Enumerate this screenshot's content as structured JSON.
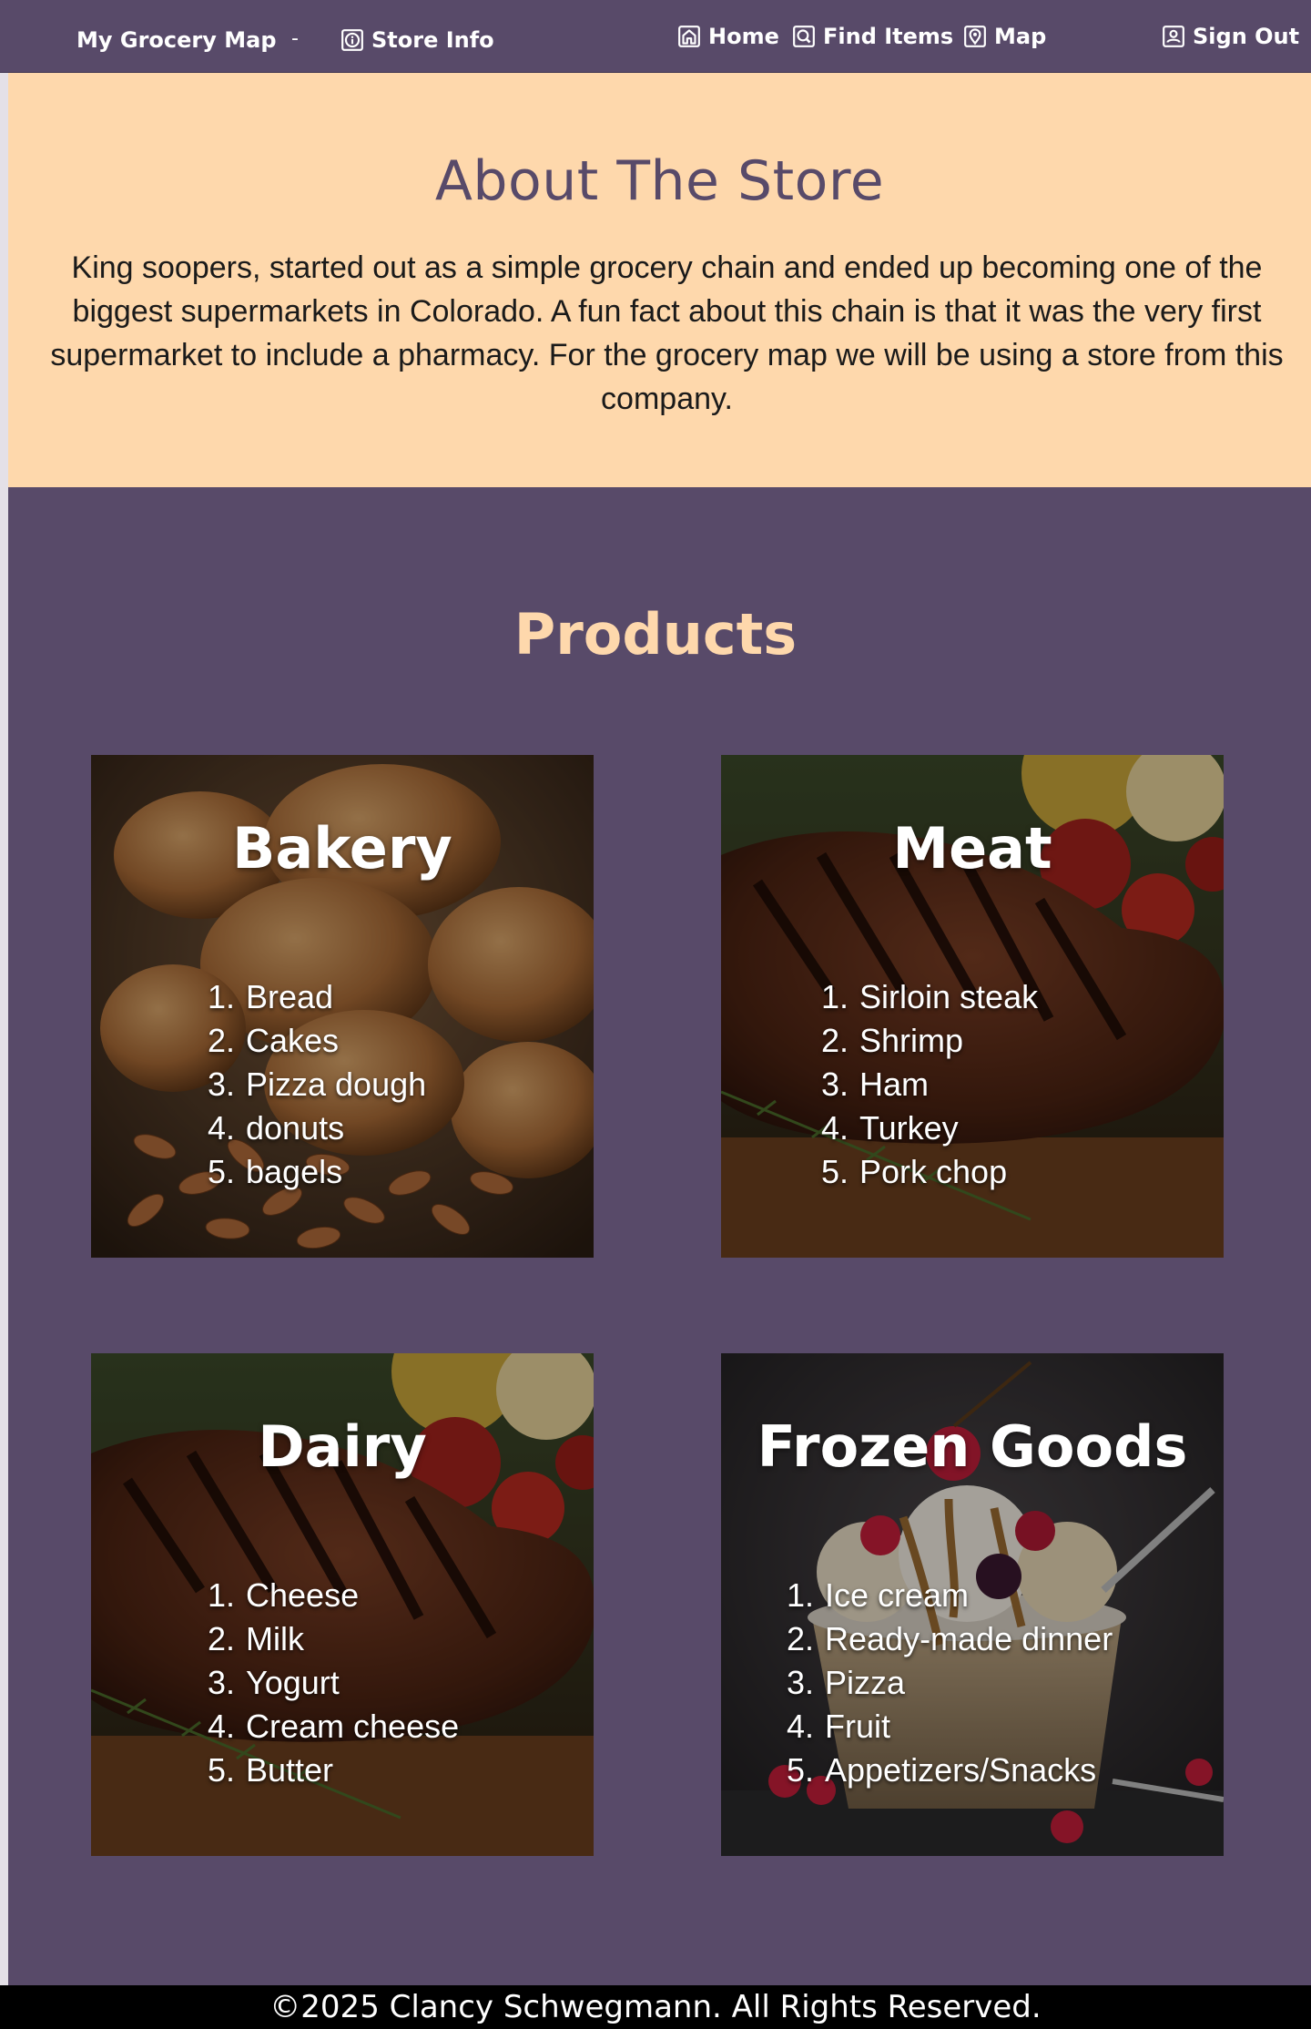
{
  "navbar": {
    "brand": "My Grocery Map",
    "separator": "-",
    "store_info": "Store Info",
    "home": "Home",
    "find_items": "Find Items",
    "map": "Map",
    "sign_out": "Sign Out"
  },
  "about": {
    "title": "About The Store",
    "text": "King soopers, started out as a simple grocery chain and ended up becoming one of the biggest supermarkets in Colorado. A fun fact about this chain is that it was the very first supermarket to include a pharmacy. For the grocery map we will be using a store from this company."
  },
  "products": {
    "title": "Products",
    "cards": [
      {
        "title": "Bakery",
        "items": [
          "Bread",
          "Cakes",
          "Pizza dough",
          "donuts",
          "bagels"
        ],
        "image": "bread-and-almonds"
      },
      {
        "title": "Meat",
        "items": [
          "Sirloin steak",
          "Shrimp",
          "Ham",
          "Turkey",
          "Pork chop"
        ],
        "image": "grilled-steak"
      },
      {
        "title": "Dairy",
        "items": [
          "Cheese",
          "Milk",
          "Yogurt",
          "Cream cheese",
          "Butter"
        ],
        "image": "grilled-steak"
      },
      {
        "title": "Frozen Goods",
        "items": [
          "Ice cream",
          "Ready-made dinner",
          "Pizza",
          "Fruit",
          "Appetizers/Snacks"
        ],
        "image": "ice-cream-sundae"
      }
    ]
  },
  "footer": {
    "text": "©2025 Clancy Schwegmann. All Rights Reserved."
  },
  "colors": {
    "primary": "#584a69",
    "accent": "#fed8ac",
    "footer_bg": "#000000"
  }
}
